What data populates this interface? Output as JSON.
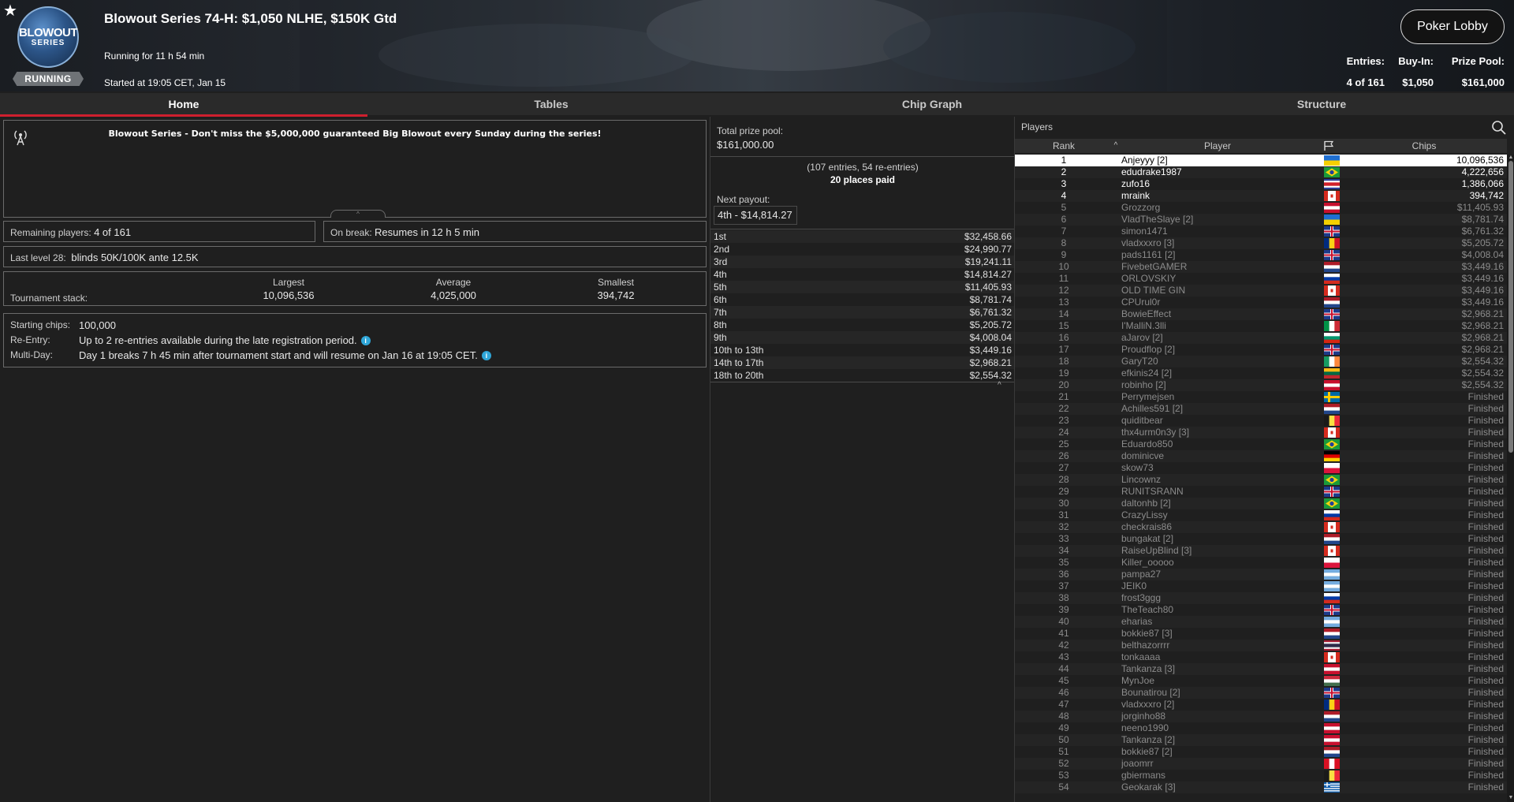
{
  "header": {
    "title": "Blowout Series 74-H: $1,050 NLHE, $150K Gtd",
    "running_for": "Running for 11 h 54 min",
    "started_at": "Started at 19:05 CET, Jan 15",
    "logo_line1": "BLOWOUT",
    "logo_line2": "SERIES",
    "status": "RUNNING",
    "lobby_button": "Poker Lobby",
    "entries_label": "Entries:",
    "entries_value": "4 of 161",
    "buyin_label": "Buy-In:",
    "buyin_value": "$1,050",
    "prize_label": "Prize Pool:",
    "prize_value": "$161,000"
  },
  "tabs": [
    {
      "label": "Home",
      "active": true
    },
    {
      "label": "Tables",
      "active": false
    },
    {
      "label": "Chip Graph",
      "active": false
    },
    {
      "label": "Structure",
      "active": false
    }
  ],
  "home": {
    "news": "Blowout Series - Don't miss the $5,000,000 guaranteed Big Blowout every Sunday during the series!",
    "remaining_label": "Remaining players:",
    "remaining_value": "4 of 161",
    "break_label": "On break:",
    "break_value": "Resumes in 12 h 5 min",
    "level_label": "Last level 28:",
    "level_value": "blinds 50K/100K ante 12.5K",
    "stack_label": "Tournament stack:",
    "largest_label": "Largest",
    "largest_value": "10,096,536",
    "average_label": "Average",
    "average_value": "4,025,000",
    "smallest_label": "Smallest",
    "smallest_value": "394,742",
    "starting_label": "Starting chips:",
    "starting_value": "100,000",
    "reentry_label": "Re-Entry:",
    "reentry_value": "Up to 2 re-entries available during the late registration period.",
    "multiday_label": "Multi-Day:",
    "multiday_value": "Day 1 breaks 7 h 45 min after tournament start and will resume on Jan 16 at 19:05 CET."
  },
  "prizes": {
    "total_label": "Total prize pool:",
    "total_value": "$161,000.00",
    "entries_note": "(107 entries, 54 re-entries)",
    "places_paid": "20 places paid",
    "next_label": "Next payout:",
    "next_value": "4th - $14,814.27",
    "payouts": [
      {
        "place": "1st",
        "amount": "$32,458.66"
      },
      {
        "place": "2nd",
        "amount": "$24,990.77"
      },
      {
        "place": "3rd",
        "amount": "$19,241.11"
      },
      {
        "place": "4th",
        "amount": "$14,814.27"
      },
      {
        "place": "5th",
        "amount": "$11,405.93"
      },
      {
        "place": "6th",
        "amount": "$8,781.74"
      },
      {
        "place": "7th",
        "amount": "$6,761.32"
      },
      {
        "place": "8th",
        "amount": "$5,205.72"
      },
      {
        "place": "9th",
        "amount": "$4,008.04"
      },
      {
        "place": "10th to 13th",
        "amount": "$3,449.16"
      },
      {
        "place": "14th to 17th",
        "amount": "$2,968.21"
      },
      {
        "place": "18th to 20th",
        "amount": "$2,554.32"
      }
    ]
  },
  "players": {
    "title": "Players",
    "col_rank": "Rank",
    "col_player": "Player",
    "col_chips": "Chips",
    "rows": [
      {
        "rank": "1",
        "name": "Anjeyyy [2]",
        "flag": "ua",
        "chips": "10,096,536",
        "state": "sel"
      },
      {
        "rank": "2",
        "name": "edudrake1987",
        "flag": "br",
        "chips": "4,222,656",
        "state": "active"
      },
      {
        "rank": "3",
        "name": "zufo16",
        "flag": "cr",
        "chips": "1,386,066",
        "state": "active"
      },
      {
        "rank": "4",
        "name": "mraink",
        "flag": "ca",
        "chips": "394,742",
        "state": "active"
      },
      {
        "rank": "5",
        "name": "Grozzorg",
        "flag": "at",
        "chips": "$11,405.93",
        "state": "out"
      },
      {
        "rank": "6",
        "name": "VladTheSlaye [2]",
        "flag": "ua",
        "chips": "$8,781.74",
        "state": "out"
      },
      {
        "rank": "7",
        "name": "simon1471",
        "flag": "gb",
        "chips": "$6,761.32",
        "state": "out"
      },
      {
        "rank": "8",
        "name": "vladxxxro [3]",
        "flag": "ro",
        "chips": "$5,205.72",
        "state": "out"
      },
      {
        "rank": "9",
        "name": "pads1161 [2]",
        "flag": "gb",
        "chips": "$4,008.04",
        "state": "out"
      },
      {
        "rank": "10",
        "name": "FivebetGAMER",
        "flag": "nl",
        "chips": "$3,449.16",
        "state": "out"
      },
      {
        "rank": "11",
        "name": "ORLOVSKIY",
        "flag": "ru",
        "chips": "$3,449.16",
        "state": "out"
      },
      {
        "rank": "12",
        "name": "OLD TIME GIN",
        "flag": "ca",
        "chips": "$3,449.16",
        "state": "out"
      },
      {
        "rank": "13",
        "name": "CPUrul0r",
        "flag": "nl",
        "chips": "$3,449.16",
        "state": "out"
      },
      {
        "rank": "14",
        "name": "BowieEffect",
        "flag": "gb",
        "chips": "$2,968.21",
        "state": "out"
      },
      {
        "rank": "15",
        "name": "I'MalliN.3lli",
        "flag": "it",
        "chips": "$2,968.21",
        "state": "out"
      },
      {
        "rank": "16",
        "name": "aJarov [2]",
        "flag": "bg",
        "chips": "$2,968.21",
        "state": "out"
      },
      {
        "rank": "17",
        "name": "Proudflop [2]",
        "flag": "gb",
        "chips": "$2,968.21",
        "state": "out"
      },
      {
        "rank": "18",
        "name": "GaryT20",
        "flag": "ie",
        "chips": "$2,554.32",
        "state": "out"
      },
      {
        "rank": "19",
        "name": "efkinis24 [2]",
        "flag": "lt",
        "chips": "$2,554.32",
        "state": "out"
      },
      {
        "rank": "20",
        "name": "robinho [2]",
        "flag": "at",
        "chips": "$2,554.32",
        "state": "out"
      },
      {
        "rank": "21",
        "name": "Perrymejsen",
        "flag": "se",
        "chips": "Finished",
        "state": "out"
      },
      {
        "rank": "22",
        "name": "Achilles591 [2]",
        "flag": "nl",
        "chips": "Finished",
        "state": "out"
      },
      {
        "rank": "23",
        "name": "quiditbear",
        "flag": "be",
        "chips": "Finished",
        "state": "out"
      },
      {
        "rank": "24",
        "name": "thx4urm0n3y [3]",
        "flag": "ca",
        "chips": "Finished",
        "state": "out"
      },
      {
        "rank": "25",
        "name": "Eduardo850",
        "flag": "br",
        "chips": "Finished",
        "state": "out"
      },
      {
        "rank": "26",
        "name": "dominicve",
        "flag": "de",
        "chips": "Finished",
        "state": "out"
      },
      {
        "rank": "27",
        "name": "skow73",
        "flag": "pl",
        "chips": "Finished",
        "state": "out"
      },
      {
        "rank": "28",
        "name": "Lincownz",
        "flag": "br",
        "chips": "Finished",
        "state": "out"
      },
      {
        "rank": "29",
        "name": "RUNITSRANN",
        "flag": "gb",
        "chips": "Finished",
        "state": "out"
      },
      {
        "rank": "30",
        "name": "daltonhb [2]",
        "flag": "br",
        "chips": "Finished",
        "state": "out"
      },
      {
        "rank": "31",
        "name": "CrazyLissy",
        "flag": "ru",
        "chips": "Finished",
        "state": "out"
      },
      {
        "rank": "32",
        "name": "checkrais86",
        "flag": "ca",
        "chips": "Finished",
        "state": "out"
      },
      {
        "rank": "33",
        "name": "bungakat [2]",
        "flag": "nl",
        "chips": "Finished",
        "state": "out"
      },
      {
        "rank": "34",
        "name": "RaiseUpBlind [3]",
        "flag": "ca",
        "chips": "Finished",
        "state": "out"
      },
      {
        "rank": "35",
        "name": "Killer_ooooo",
        "flag": "pl",
        "chips": "Finished",
        "state": "out"
      },
      {
        "rank": "36",
        "name": "pampa27",
        "flag": "ar",
        "chips": "Finished",
        "state": "out"
      },
      {
        "rank": "37",
        "name": "JEIK0",
        "flag": "ar",
        "chips": "Finished",
        "state": "out"
      },
      {
        "rank": "38",
        "name": "frost3ggg",
        "flag": "ru",
        "chips": "Finished",
        "state": "out"
      },
      {
        "rank": "39",
        "name": "TheTeach80",
        "flag": "gb",
        "chips": "Finished",
        "state": "out"
      },
      {
        "rank": "40",
        "name": "eharias",
        "flag": "ar",
        "chips": "Finished",
        "state": "out"
      },
      {
        "rank": "41",
        "name": "bokkie87 [3]",
        "flag": "nl",
        "chips": "Finished",
        "state": "out"
      },
      {
        "rank": "42",
        "name": "belthazorrrr",
        "flag": "th",
        "chips": "Finished",
        "state": "out"
      },
      {
        "rank": "43",
        "name": "tonkaaaa",
        "flag": "ca",
        "chips": "Finished",
        "state": "out"
      },
      {
        "rank": "44",
        "name": "Tankanza [3]",
        "flag": "at",
        "chips": "Finished",
        "state": "out"
      },
      {
        "rank": "45",
        "name": "MynJoe",
        "flag": "hu",
        "chips": "Finished",
        "state": "out"
      },
      {
        "rank": "46",
        "name": "Bounatirou [2]",
        "flag": "gb",
        "chips": "Finished",
        "state": "out"
      },
      {
        "rank": "47",
        "name": "vladxxxro [2]",
        "flag": "ro",
        "chips": "Finished",
        "state": "out"
      },
      {
        "rank": "48",
        "name": "jorginho88",
        "flag": "nl",
        "chips": "Finished",
        "state": "out"
      },
      {
        "rank": "49",
        "name": "neeno1990",
        "flag": "at",
        "chips": "Finished",
        "state": "out"
      },
      {
        "rank": "50",
        "name": "Tankanza [2]",
        "flag": "at",
        "chips": "Finished",
        "state": "out"
      },
      {
        "rank": "51",
        "name": "bokkie87 [2]",
        "flag": "nl",
        "chips": "Finished",
        "state": "out"
      },
      {
        "rank": "52",
        "name": "joaomrr",
        "flag": "pe",
        "chips": "Finished",
        "state": "out"
      },
      {
        "rank": "53",
        "name": "gbiermans",
        "flag": "be",
        "chips": "Finished",
        "state": "out"
      },
      {
        "rank": "54",
        "name": "Geokarak [3]",
        "flag": "gr",
        "chips": "Finished",
        "state": "out"
      }
    ]
  }
}
